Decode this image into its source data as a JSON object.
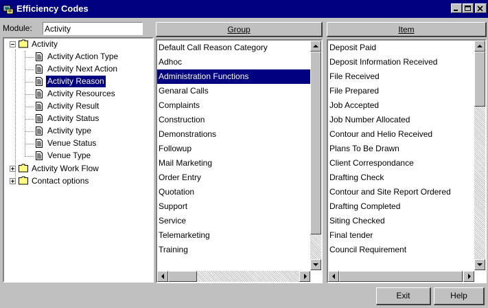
{
  "window": {
    "title": "Efficiency Codes"
  },
  "module": {
    "label": "Module:",
    "value": "Activity"
  },
  "tree": {
    "root": "Activity",
    "children": [
      "Activity Action  Type",
      "Activity Next Action",
      "Activity Reason",
      "Activity Resources",
      "Activity Result",
      "Activity Status",
      "Activity type",
      "Venue Status",
      "Venue Type"
    ],
    "selected": "Activity Reason",
    "siblings": [
      "Activity Work Flow",
      "Contact options"
    ]
  },
  "group": {
    "header": "Group",
    "items": [
      "Default Call Reason Category",
      "Adhoc",
      "Administration Functions",
      "Genaral Calls",
      "Complaints",
      "Construction",
      "Demonstrations",
      "Followup",
      "Mail Marketing",
      "Order Entry",
      "Quotation",
      "Support",
      "Service",
      "Telemarketing",
      "Training"
    ],
    "selected": "Administration Functions"
  },
  "item": {
    "header": "Item",
    "items": [
      "Deposit Paid",
      "Deposit Information Received",
      "File Received",
      "File Prepared",
      "Job Accepted",
      "Job Number Allocated",
      "Contour and Helio Received",
      "Plans To Be Drawn",
      "Client Correspondance",
      "Drafting Check",
      "Contour and Site Report Ordered",
      "Drafting Completed",
      "Siting Checked",
      "Final tender",
      "Council Requirement"
    ]
  },
  "buttons": {
    "exit": "Exit",
    "help": "Help"
  },
  "colors": {
    "titlebar": "#000080",
    "selection": "#000080",
    "face": "#c0c0c0"
  }
}
